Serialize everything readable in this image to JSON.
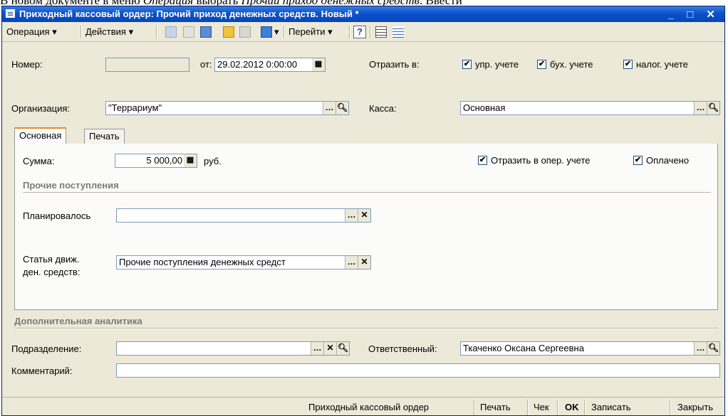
{
  "doc_caption": {
    "prefix": "В новом документе в меню ",
    "menu": "Операция",
    "middle": " выбрать ",
    "item": "Прочий приход денежных средств",
    "suffix": ". Ввести"
  },
  "window": {
    "title": "Приходный кассовый ордер: Прочий приход денежных средств. Новый *",
    "controls": "_ □ ✕"
  },
  "toolbar": {
    "operation_label": "Операция ▾",
    "actions_label": "Действия ▾",
    "goto_label": "Перейти ▾",
    "help_label": "?"
  },
  "header": {
    "number_label": "Номер:",
    "number_value": "",
    "date_from_label": "от:",
    "date_value": "29.02.2012  0:00:00",
    "reflect_label": "Отразить в:",
    "reflect_mgmt": "упр. учете",
    "reflect_acc": "бух. учете",
    "reflect_tax": "налог. учете",
    "org_label": "Организация:",
    "org_value": "\"Террариум\"",
    "cash_label": "Касса:",
    "cash_value": "Основная"
  },
  "tabs": [
    {
      "label": "Основная"
    },
    {
      "label": "Печать"
    }
  ],
  "main_tab": {
    "sum_label": "Сумма:",
    "sum_value": "5 000,00",
    "currency": "руб.",
    "reflect_oper": "Отразить в опер. учете",
    "paid": "Оплачено",
    "section_other": "Прочие поступления",
    "planned_label": "Планировалось",
    "planned_value": "",
    "article_label_1": "Статья движ.",
    "article_label_2": "ден. средств:",
    "article_value": "Прочие поступления денежных средст"
  },
  "analytics": {
    "section": "Дополнительная аналитика",
    "department_label": "Подразделение:",
    "department_value": "",
    "responsible_label": "Ответственный:",
    "responsible_value": "Ткаченко Оксана Сергеевна",
    "comment_label": "Комментарий:",
    "comment_value": ""
  },
  "footer": {
    "receipt_order": "Приходный кассовый ордер",
    "print": "Печать",
    "check": "Чек",
    "ok": "OK",
    "save": "Записать",
    "close": "Закрыть"
  },
  "colors": {
    "title_bar": "#0a52cc",
    "window_bg": "#ece9d8",
    "check_mark": "#21a121"
  }
}
